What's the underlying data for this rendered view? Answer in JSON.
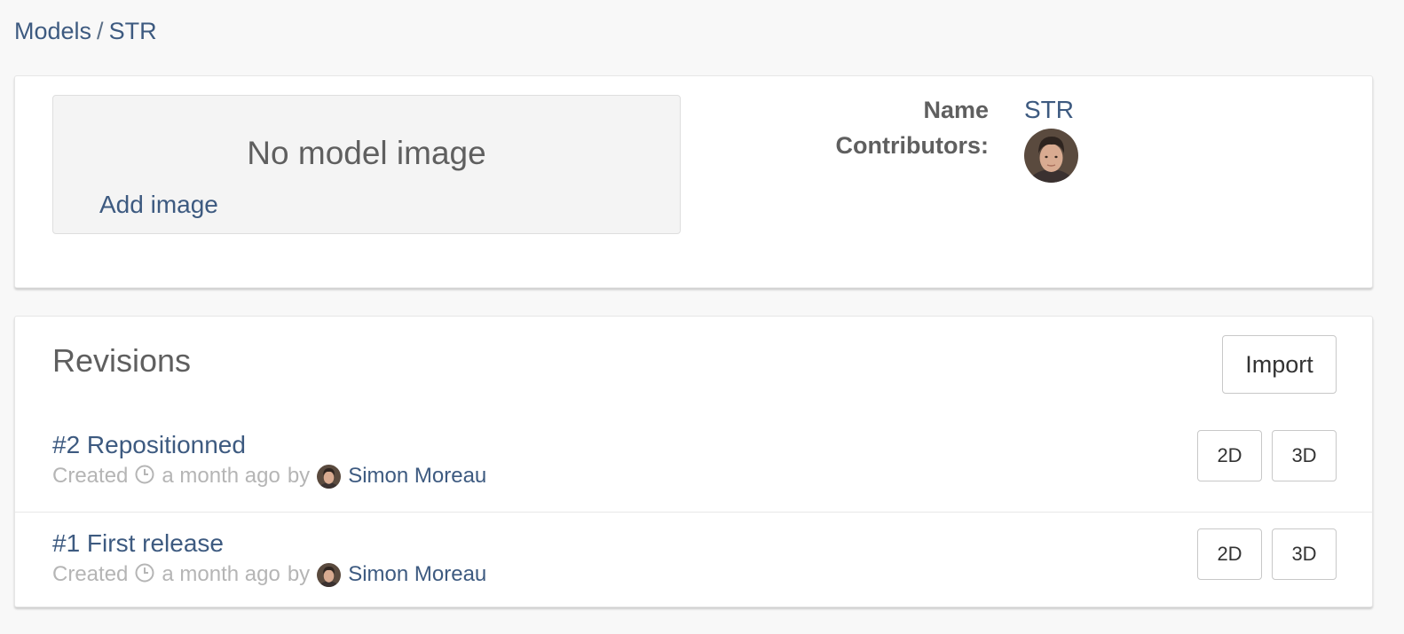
{
  "breadcrumb": {
    "parent": "Models",
    "separator": "/",
    "current": "STR"
  },
  "model": {
    "no_image_text": "No model image",
    "add_image_label": "Add image",
    "name_label": "Name",
    "name_value": "STR",
    "contributors_label": "Contributors:",
    "contributors": [
      {
        "avatar_icon": "user-avatar-simon-moreau"
      }
    ]
  },
  "revisions": {
    "title": "Revisions",
    "import_label": "Import",
    "items": [
      {
        "title": "#2 Repositionned",
        "created_label": "Created",
        "time_ago": "a month ago",
        "by_label": "by",
        "author": "Simon Moreau",
        "btn_2d": "2D",
        "btn_3d": "3D"
      },
      {
        "title": "#1 First release",
        "created_label": "Created",
        "time_ago": "a month ago",
        "by_label": "by",
        "author": "Simon Moreau",
        "btn_2d": "2D",
        "btn_3d": "3D"
      }
    ]
  },
  "colors": {
    "link": "#3d5a80",
    "text": "#5f5f5f",
    "muted": "#b5b5b5",
    "background": "#f8f8f8"
  }
}
